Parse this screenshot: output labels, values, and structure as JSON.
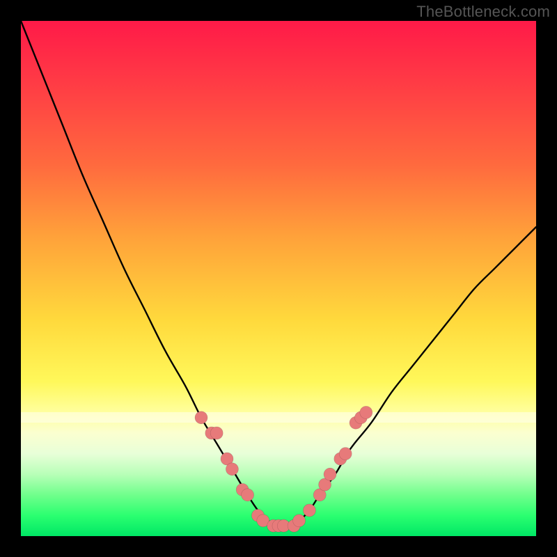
{
  "watermark": "TheBottleneck.com",
  "colors": {
    "page_bg": "#000000",
    "curve_stroke": "#000000",
    "marker_fill": "#e77a7a",
    "gradient_top": "#ff1a48",
    "gradient_bottom": "#00e765"
  },
  "chart_data": {
    "type": "line",
    "title": "",
    "xlabel": "",
    "ylabel": "",
    "xlim": [
      0,
      100
    ],
    "ylim": [
      0,
      100
    ],
    "grid": false,
    "legend": false,
    "note": "No axis ticks or numeric labels are rendered; values are estimated from curve geometry (0–100 range on both axes). Lower y = better (green band at bottom).",
    "series": [
      {
        "name": "bottleneck-curve",
        "x": [
          0,
          4,
          8,
          12,
          16,
          20,
          24,
          28,
          32,
          35,
          38,
          41,
          44,
          46,
          48,
          50,
          52,
          54,
          56,
          58,
          61,
          64,
          68,
          72,
          76,
          80,
          84,
          88,
          92,
          96,
          100
        ],
        "y": [
          100,
          90,
          80,
          70,
          61,
          52,
          44,
          36,
          29,
          23,
          18,
          13,
          8,
          5,
          3,
          2,
          2,
          3,
          5,
          8,
          12,
          17,
          22,
          28,
          33,
          38,
          43,
          48,
          52,
          56,
          60
        ]
      }
    ],
    "markers": {
      "name": "highlighted-points",
      "points": [
        {
          "x": 35,
          "y": 23
        },
        {
          "x": 37,
          "y": 20
        },
        {
          "x": 38,
          "y": 20
        },
        {
          "x": 40,
          "y": 15
        },
        {
          "x": 41,
          "y": 13
        },
        {
          "x": 43,
          "y": 9
        },
        {
          "x": 44,
          "y": 8
        },
        {
          "x": 46,
          "y": 4
        },
        {
          "x": 47,
          "y": 3
        },
        {
          "x": 49,
          "y": 2
        },
        {
          "x": 50,
          "y": 2
        },
        {
          "x": 51,
          "y": 2
        },
        {
          "x": 53,
          "y": 2
        },
        {
          "x": 54,
          "y": 3
        },
        {
          "x": 56,
          "y": 5
        },
        {
          "x": 58,
          "y": 8
        },
        {
          "x": 59,
          "y": 10
        },
        {
          "x": 60,
          "y": 12
        },
        {
          "x": 62,
          "y": 15
        },
        {
          "x": 63,
          "y": 16
        },
        {
          "x": 65,
          "y": 22
        },
        {
          "x": 66,
          "y": 23
        },
        {
          "x": 67,
          "y": 24
        }
      ],
      "radius": 9
    },
    "background_bands": [
      {
        "name": "pale-accent-stripe",
        "y": 22,
        "height_pct": 2
      }
    ]
  }
}
